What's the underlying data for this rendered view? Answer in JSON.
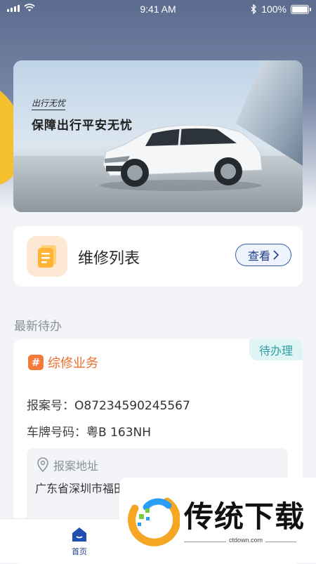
{
  "status_bar": {
    "time": "9:41 AM",
    "battery": "100%",
    "battery_level": 1.0
  },
  "banner": {
    "slogan_small": "出行无忧",
    "slogan_main": "保障出行平安无忧"
  },
  "repair": {
    "title": "维修列表",
    "view_label": "查看"
  },
  "section": {
    "title": "最新待办"
  },
  "todo": {
    "status": "待办理",
    "type": "综修业务",
    "type_icon": "#",
    "case_label": "报案号：",
    "case_value": "O87234590245567",
    "plate_label": "车牌号码：",
    "plate_value": "粤B 163NH",
    "address_label": "报案地址",
    "address_text": "广东省深圳市福田区口东100米"
  },
  "tabbar": {
    "home_label": "首页"
  },
  "watermark": {
    "text": "传统下载",
    "domain": "ctdown.com"
  },
  "colors": {
    "accent": "#1e3f8a",
    "orange": "#ef6d2b",
    "teal": "#2f9ea4",
    "yellow": "#f5c02d"
  }
}
